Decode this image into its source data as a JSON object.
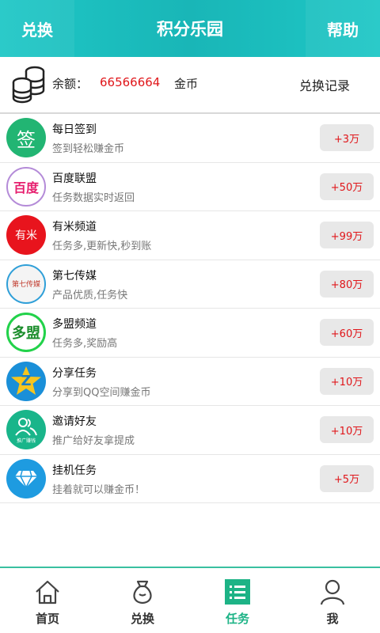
{
  "header": {
    "left_label": "兑换",
    "title": "积分乐园",
    "right_label": "帮助"
  },
  "balance": {
    "label": "余额：",
    "value": "66566664",
    "unit": "金币",
    "history_label": "兑换记录",
    "icon": "coin-stack-icon"
  },
  "tasks": [
    {
      "name": "每日签到",
      "desc": "签到轻松赚金币",
      "reward": "+3万",
      "icon_text": "签",
      "icon": "sign-in-icon"
    },
    {
      "name": "百度联盟",
      "desc": "任务数据实时返回",
      "reward": "+50万",
      "icon_text": "百度",
      "icon": "baidu-icon"
    },
    {
      "name": "有米频道",
      "desc": "任务多,更新快,秒到账",
      "reward": "+99万",
      "icon_text": "有米",
      "icon": "youmi-icon"
    },
    {
      "name": "第七传媒",
      "desc": "产品优质,任务快",
      "reward": "+80万",
      "icon_text": "第七传媒",
      "icon": "diqi-icon"
    },
    {
      "name": "多盟频道",
      "desc": "任务多,奖励高",
      "reward": "+60万",
      "icon_text": "多盟",
      "icon": "duomeng-icon"
    },
    {
      "name": "分享任务",
      "desc": "分享到QQ空间赚金币",
      "reward": "+10万",
      "icon_text": "Z",
      "icon": "qzone-star-icon"
    },
    {
      "name": "邀请好友",
      "desc": "推广给好友拿提成",
      "reward": "+10万",
      "icon_text": "推广赚钱",
      "icon": "invite-friends-icon"
    },
    {
      "name": "挂机任务",
      "desc": "挂着就可以赚金币！",
      "reward": "+5万",
      "icon_text": "",
      "icon": "diamond-icon"
    }
  ],
  "tabs": [
    {
      "label": "首页",
      "icon": "home-icon"
    },
    {
      "label": "兑换",
      "icon": "money-bag-icon"
    },
    {
      "label": "任务",
      "icon": "task-list-icon"
    },
    {
      "label": "我",
      "icon": "user-icon"
    }
  ],
  "colors": {
    "accent": "#1ec7c6",
    "reward_text": "#e0161a",
    "tab_active": "#1db386"
  }
}
